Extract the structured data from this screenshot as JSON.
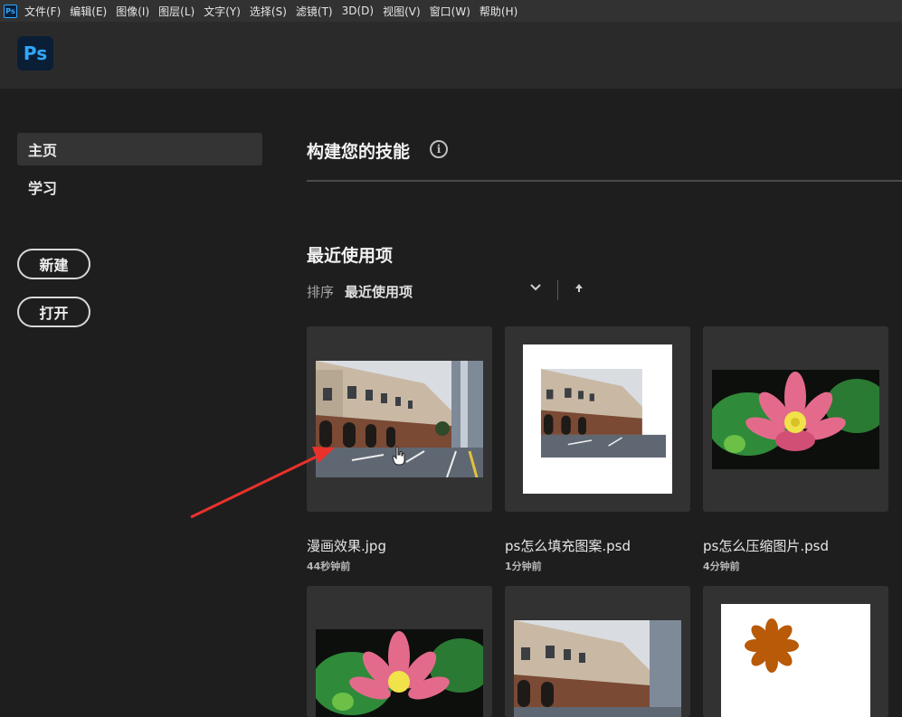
{
  "menubar": {
    "app_icon": "Ps",
    "items": [
      "文件(F)",
      "编辑(E)",
      "图像(I)",
      "图层(L)",
      "文字(Y)",
      "选择(S)",
      "滤镜(T)",
      "3D(D)",
      "视图(V)",
      "窗口(W)",
      "帮助(H)"
    ]
  },
  "header": {
    "logo": "Ps"
  },
  "sidebar": {
    "nav": [
      {
        "label": "主页",
        "active": true
      },
      {
        "label": "学习",
        "active": false
      }
    ],
    "new_button": "新建",
    "open_button": "打开"
  },
  "main": {
    "skills_title": "构建您的技能",
    "info_icon": "i",
    "recent_title": "最近使用项",
    "sort_label": "排序",
    "sort_value": "最近使用项",
    "sort_chevron": "chevron-down-icon",
    "sort_direction": "arrow-up-icon",
    "files": [
      {
        "name": "漫画效果.jpg",
        "time": "44秒钟前",
        "thumb": "street"
      },
      {
        "name": "ps怎么填充图案.psd",
        "time": "1分钟前",
        "thumb": "street-on-white"
      },
      {
        "name": "ps怎么压缩图片.psd",
        "time": "4分钟前",
        "thumb": "lotus"
      },
      {
        "name": "",
        "time": "",
        "thumb": "lotus"
      },
      {
        "name": "",
        "time": "",
        "thumb": "street"
      },
      {
        "name": "",
        "time": "",
        "thumb": "flower-on-white"
      }
    ]
  },
  "colors": {
    "accent": "#31a8ff",
    "annotation_arrow": "#e8322b"
  }
}
